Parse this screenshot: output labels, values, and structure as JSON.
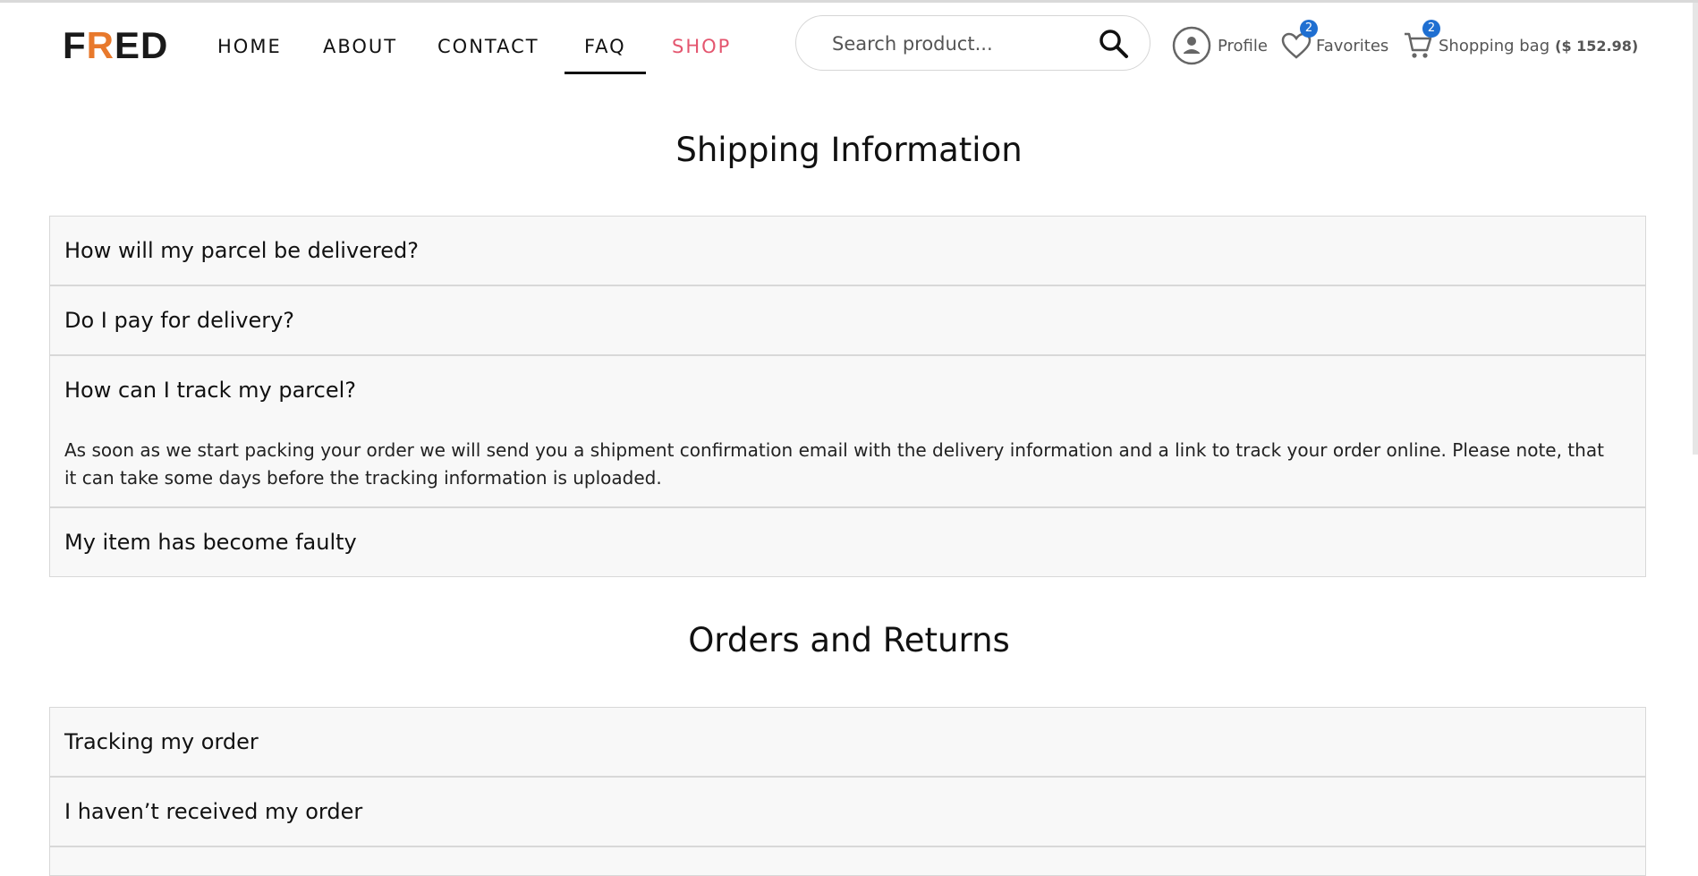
{
  "header": {
    "logo": {
      "part1": "F",
      "part2": "R",
      "part3": "ED",
      "accent_color": "#e8792c"
    },
    "nav": {
      "home": "HOME",
      "about": "ABOUT",
      "contact": "CONTACT",
      "faq": "FAQ",
      "shop": "SHOP",
      "active": "FAQ",
      "shop_color": "#e4566f"
    },
    "search": {
      "placeholder": "Search product...",
      "icon": "search-icon"
    },
    "profile": {
      "label": "Profile",
      "icon": "user-circle-icon"
    },
    "favorites": {
      "label": "Favorites",
      "count": "2",
      "icon": "heart-icon"
    },
    "bag": {
      "label": "Shopping bag",
      "total": "($ 152.98)",
      "count": "2",
      "icon": "cart-icon",
      "badge_color": "#1f6fd1"
    }
  },
  "shipping": {
    "title": "Shipping Information",
    "items": [
      {
        "question": "How will my parcel be delivered?"
      },
      {
        "question": "Do I pay for delivery?"
      },
      {
        "question": "How can I track my parcel?",
        "answer": "As soon as we start packing your order we will send you a shipment confirmation email with the delivery information and a link to track your order online. Please note, that it can take some days before the tracking information is uploaded."
      },
      {
        "question": "My item has become faulty"
      }
    ]
  },
  "orders": {
    "title": "Orders and Returns",
    "items": [
      {
        "question": "Tracking my order"
      },
      {
        "question": "I haven’t received my order"
      }
    ]
  }
}
